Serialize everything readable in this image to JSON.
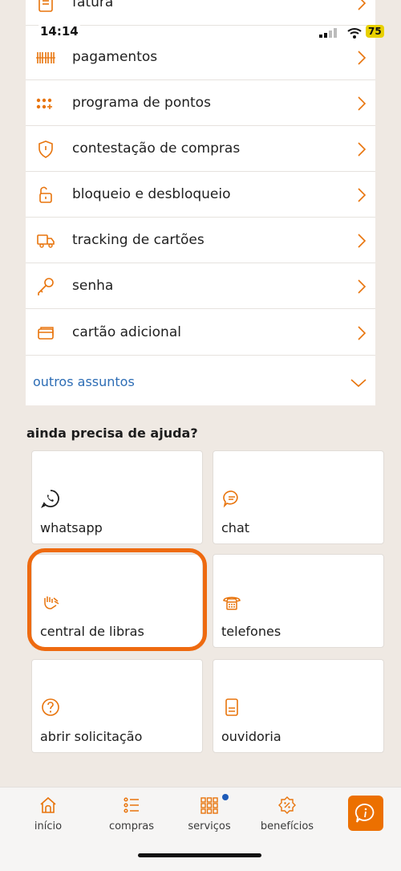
{
  "status_bar": {
    "time": "14:14",
    "battery": "75"
  },
  "menu": {
    "items": [
      {
        "label": "fatura",
        "icon": "invoice-icon"
      },
      {
        "label": "pagamentos",
        "icon": "barcode-icon"
      },
      {
        "label": "programa de pontos",
        "icon": "points-icon"
      },
      {
        "label": "contestação de compras",
        "icon": "shield-icon"
      },
      {
        "label": "bloqueio e desbloqueio",
        "icon": "unlock-icon"
      },
      {
        "label": "tracking de cartões",
        "icon": "truck-icon"
      },
      {
        "label": "senha",
        "icon": "key-icon"
      },
      {
        "label": "cartão adicional",
        "icon": "card-icon"
      }
    ],
    "other": "outros assuntos"
  },
  "help": {
    "title": "ainda precisa de ajuda?",
    "tiles": [
      {
        "label": "whatsapp",
        "icon": "whatsapp-icon"
      },
      {
        "label": "chat",
        "icon": "chat-icon"
      },
      {
        "label": "central de libras",
        "icon": "sign-language-icon"
      },
      {
        "label": "telefones",
        "icon": "phone-icon"
      },
      {
        "label": "abrir solicitação",
        "icon": "question-icon"
      },
      {
        "label": "ouvidoria",
        "icon": "document-icon"
      }
    ]
  },
  "tabbar": {
    "tabs": [
      {
        "label": "início",
        "icon": "home-icon"
      },
      {
        "label": "compras",
        "icon": "list-icon"
      },
      {
        "label": "serviços",
        "icon": "grid-icon"
      },
      {
        "label": "benefícios",
        "icon": "percent-badge-icon"
      }
    ]
  },
  "colors": {
    "accent": "#ec7000",
    "link": "#2d6db5",
    "icon": "#e8740c",
    "background": "#efe9e3"
  }
}
